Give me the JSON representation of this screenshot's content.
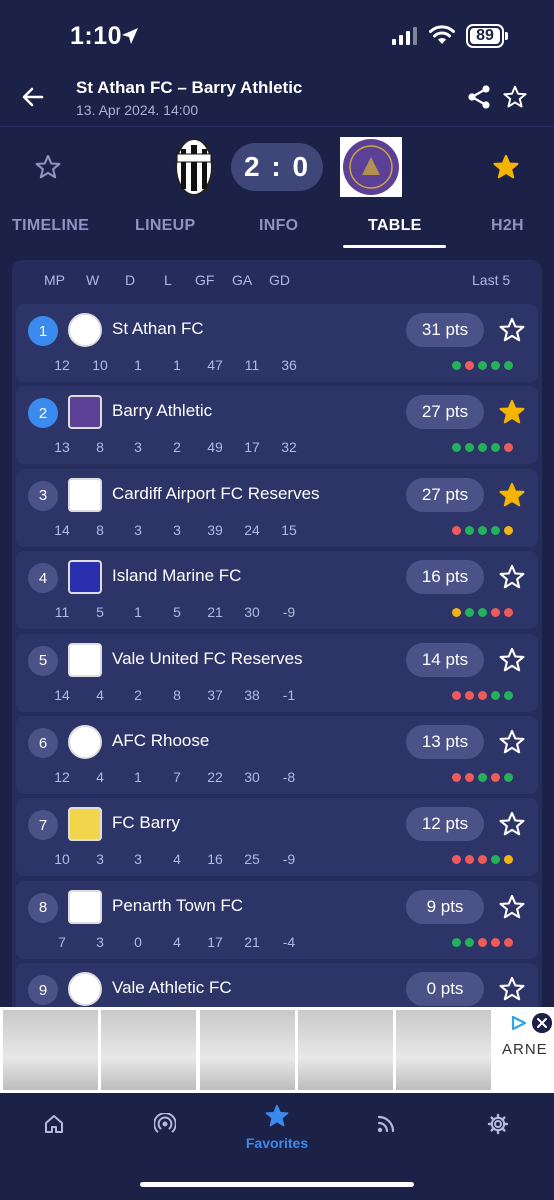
{
  "status": {
    "time": "1:10",
    "battery": "89"
  },
  "header": {
    "title": "St Athan FC – Barry Athletic",
    "date": "13. Apr 2024. 14:00"
  },
  "match": {
    "score": "2 : 0"
  },
  "tabs": [
    {
      "label": "TIMELINE"
    },
    {
      "label": "LINEUP"
    },
    {
      "label": "INFO"
    },
    {
      "label": "TABLE",
      "active": true
    },
    {
      "label": "H2H"
    }
  ],
  "table": {
    "columns": [
      "MP",
      "W",
      "D",
      "L",
      "GF",
      "GA",
      "GD"
    ],
    "last5_label": "Last 5",
    "rows": [
      {
        "rank": "1",
        "team": "St Athan FC",
        "pts": "31 pts",
        "favorite": false,
        "highlight": true,
        "mp": "12",
        "w": "10",
        "d": "1",
        "l": "1",
        "gf": "47",
        "ga": "11",
        "gd": "36",
        "form": [
          "win",
          "loss",
          "win",
          "win",
          "win"
        ]
      },
      {
        "rank": "2",
        "team": "Barry Athletic",
        "pts": "27 pts",
        "favorite": true,
        "highlight": true,
        "mp": "13",
        "w": "8",
        "d": "3",
        "l": "2",
        "gf": "49",
        "ga": "17",
        "gd": "32",
        "form": [
          "win",
          "win",
          "win",
          "win",
          "loss"
        ]
      },
      {
        "rank": "3",
        "team": "Cardiff Airport FC Reserves",
        "pts": "27 pts",
        "favorite": true,
        "highlight": false,
        "mp": "14",
        "w": "8",
        "d": "3",
        "l": "3",
        "gf": "39",
        "ga": "24",
        "gd": "15",
        "form": [
          "loss",
          "win",
          "win",
          "win",
          "draw"
        ]
      },
      {
        "rank": "4",
        "team": "Island Marine FC",
        "pts": "16 pts",
        "favorite": false,
        "highlight": false,
        "mp": "11",
        "w": "5",
        "d": "1",
        "l": "5",
        "gf": "21",
        "ga": "30",
        "gd": "-9",
        "form": [
          "draw",
          "win",
          "win",
          "loss",
          "loss"
        ]
      },
      {
        "rank": "5",
        "team": "Vale United FC Reserves",
        "pts": "14 pts",
        "favorite": false,
        "highlight": false,
        "mp": "14",
        "w": "4",
        "d": "2",
        "l": "8",
        "gf": "37",
        "ga": "38",
        "gd": "-1",
        "form": [
          "loss",
          "loss",
          "loss",
          "win",
          "win"
        ]
      },
      {
        "rank": "6",
        "team": "AFC Rhoose",
        "pts": "13 pts",
        "favorite": false,
        "highlight": false,
        "mp": "12",
        "w": "4",
        "d": "1",
        "l": "7",
        "gf": "22",
        "ga": "30",
        "gd": "-8",
        "form": [
          "loss",
          "loss",
          "win",
          "loss",
          "win"
        ]
      },
      {
        "rank": "7",
        "team": "FC Barry",
        "pts": "12 pts",
        "favorite": false,
        "highlight": false,
        "mp": "10",
        "w": "3",
        "d": "3",
        "l": "4",
        "gf": "16",
        "ga": "25",
        "gd": "-9",
        "form": [
          "loss",
          "loss",
          "loss",
          "win",
          "draw"
        ]
      },
      {
        "rank": "8",
        "team": "Penarth Town FC",
        "pts": "9 pts",
        "favorite": false,
        "highlight": false,
        "mp": "7",
        "w": "3",
        "d": "0",
        "l": "4",
        "gf": "17",
        "ga": "21",
        "gd": "-4",
        "form": [
          "win",
          "win",
          "loss",
          "loss",
          "loss"
        ]
      },
      {
        "rank": "9",
        "team": "Vale Athletic FC",
        "pts": "0 pts",
        "favorite": false,
        "highlight": false,
        "mp": "",
        "w": "",
        "d": "",
        "l": "",
        "gf": "",
        "ga": "",
        "gd": "",
        "form": []
      }
    ]
  },
  "ad": {
    "brand": "ARNE"
  },
  "nav": {
    "favorites_label": "Favorites"
  },
  "colors": {
    "background": "#1c2148",
    "panel": "#262c5c",
    "card": "#2d3468",
    "accent": "#3b8bee",
    "pill": "#4a5287",
    "star": "#f5b400",
    "win": "#23b25a",
    "loss": "#ef5b5b",
    "draw": "#f2b316"
  }
}
